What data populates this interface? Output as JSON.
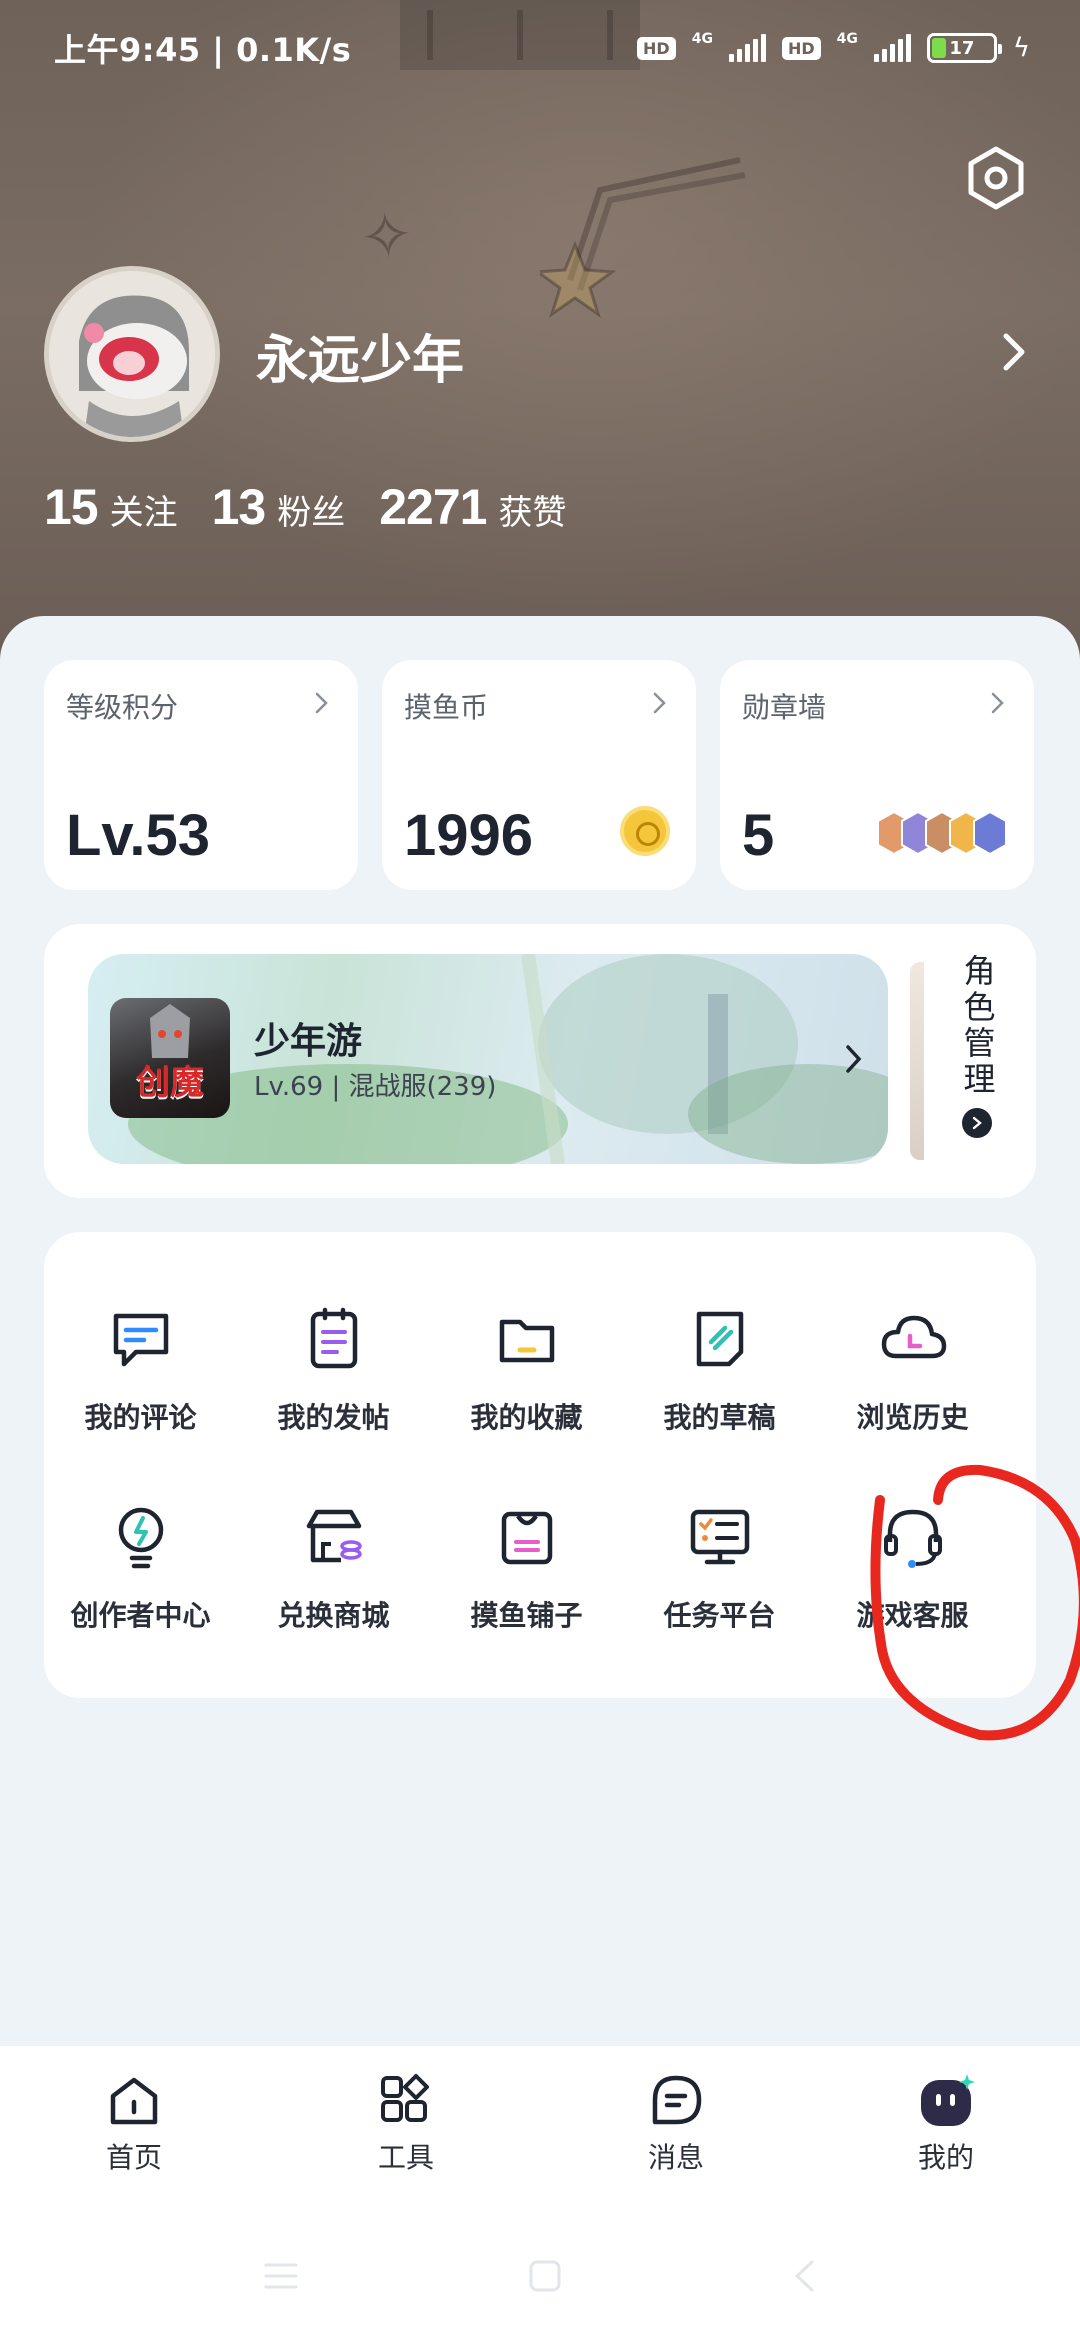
{
  "status_bar": {
    "time": "上午9:45 | 0.1K/s",
    "hd1": "HD",
    "net1": "4G",
    "hd2": "HD",
    "net2": "4G",
    "battery": "17"
  },
  "profile": {
    "username": "永远少年",
    "stats": [
      {
        "num": "15",
        "label": "关注"
      },
      {
        "num": "13",
        "label": "粉丝"
      },
      {
        "num": "2271",
        "label": "获赞"
      }
    ]
  },
  "cards": [
    {
      "title": "等级积分",
      "value": "Lv.53"
    },
    {
      "title": "摸鱼币",
      "value": "1996"
    },
    {
      "title": "勋章墙",
      "value": "5"
    }
  ],
  "game": {
    "logo_text": "创魔",
    "name": "少年游",
    "sub": "Lv.69 | 混战服(239)",
    "role_manage": "角色管理"
  },
  "functions": {
    "row1": [
      "我的评论",
      "我的发帖",
      "我的收藏",
      "我的草稿",
      "浏览历史"
    ],
    "row2": [
      "创作者中心",
      "兑换商城",
      "摸鱼铺子",
      "任务平台",
      "游戏客服"
    ]
  },
  "bottom_nav": [
    {
      "label": "首页"
    },
    {
      "label": "工具"
    },
    {
      "label": "消息"
    },
    {
      "label": "我的"
    }
  ],
  "colors": {
    "accent_blue": "#2f8cff",
    "accent_purple": "#9a5cf0",
    "accent_yellow": "#f5c63a",
    "annotation_red": "#e8281e"
  }
}
